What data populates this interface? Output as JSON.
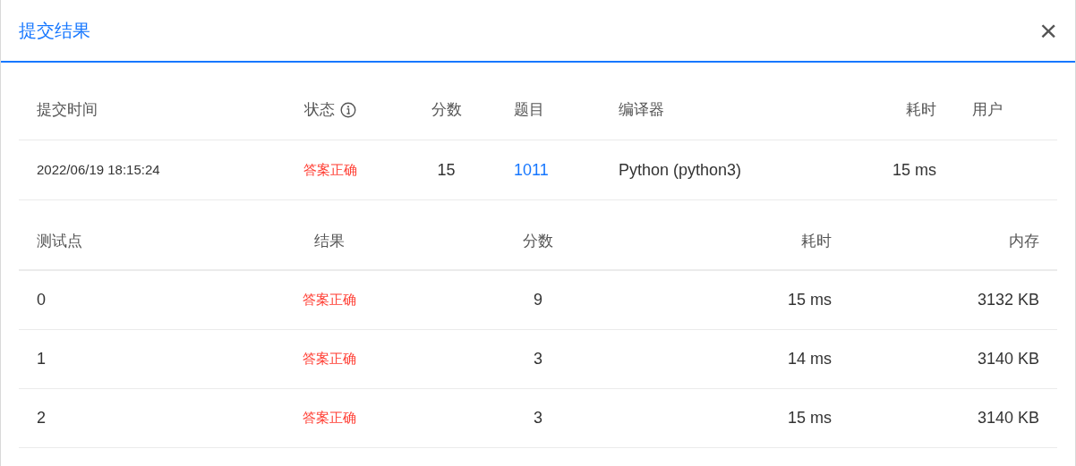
{
  "dialog": {
    "title": "提交结果",
    "close": "×"
  },
  "submission": {
    "columns": [
      {
        "label": "提交时间",
        "info": false
      },
      {
        "label": "状态",
        "info": true
      },
      {
        "label": "分数",
        "info": false
      },
      {
        "label": "题目",
        "info": false
      },
      {
        "label": "编译器",
        "info": false
      },
      {
        "label": "耗时",
        "info": false
      },
      {
        "label": "用户",
        "info": false
      }
    ],
    "row": {
      "time": "2022/06/19 18:15:24",
      "status": "答案正确",
      "score": "15",
      "problem": "1011",
      "compiler": "Python (python3)",
      "duration": "15 ms"
    }
  },
  "cases": {
    "columns": [
      {
        "label": "测试点"
      },
      {
        "label": "结果"
      },
      {
        "label": "分数"
      },
      {
        "label": "耗时"
      },
      {
        "label": "内存"
      }
    ],
    "rows": [
      {
        "case": "0",
        "result": "答案正确",
        "score": "9",
        "duration": "15 ms",
        "memory": "3132 KB"
      },
      {
        "case": "1",
        "result": "答案正确",
        "score": "3",
        "duration": "14 ms",
        "memory": "3140 KB"
      },
      {
        "case": "2",
        "result": "答案正确",
        "score": "3",
        "duration": "15 ms",
        "memory": "3140 KB"
      }
    ]
  }
}
